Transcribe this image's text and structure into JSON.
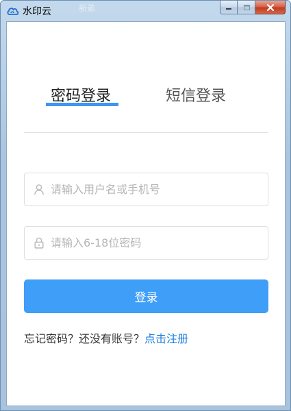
{
  "window": {
    "title": "水印云",
    "ghost_title": "新弟"
  },
  "tabs": [
    {
      "label": "密码登录",
      "active": true
    },
    {
      "label": "短信登录",
      "active": false
    }
  ],
  "form": {
    "username_placeholder": "请输入用户名或手机号",
    "username_value": "",
    "username_icon": "user-icon",
    "password_placeholder": "请输入6-18位密码",
    "password_value": "",
    "password_icon": "lock-icon",
    "login_label": "登录"
  },
  "links": {
    "forgot": "忘记密码？",
    "no_account": "还没有账号？",
    "register": "点击注册"
  },
  "colors": {
    "accent": "#3f9ef8",
    "tab_underline": "#3f95f2",
    "link": "#1a7fe0",
    "placeholder": "#b5b5b5"
  }
}
